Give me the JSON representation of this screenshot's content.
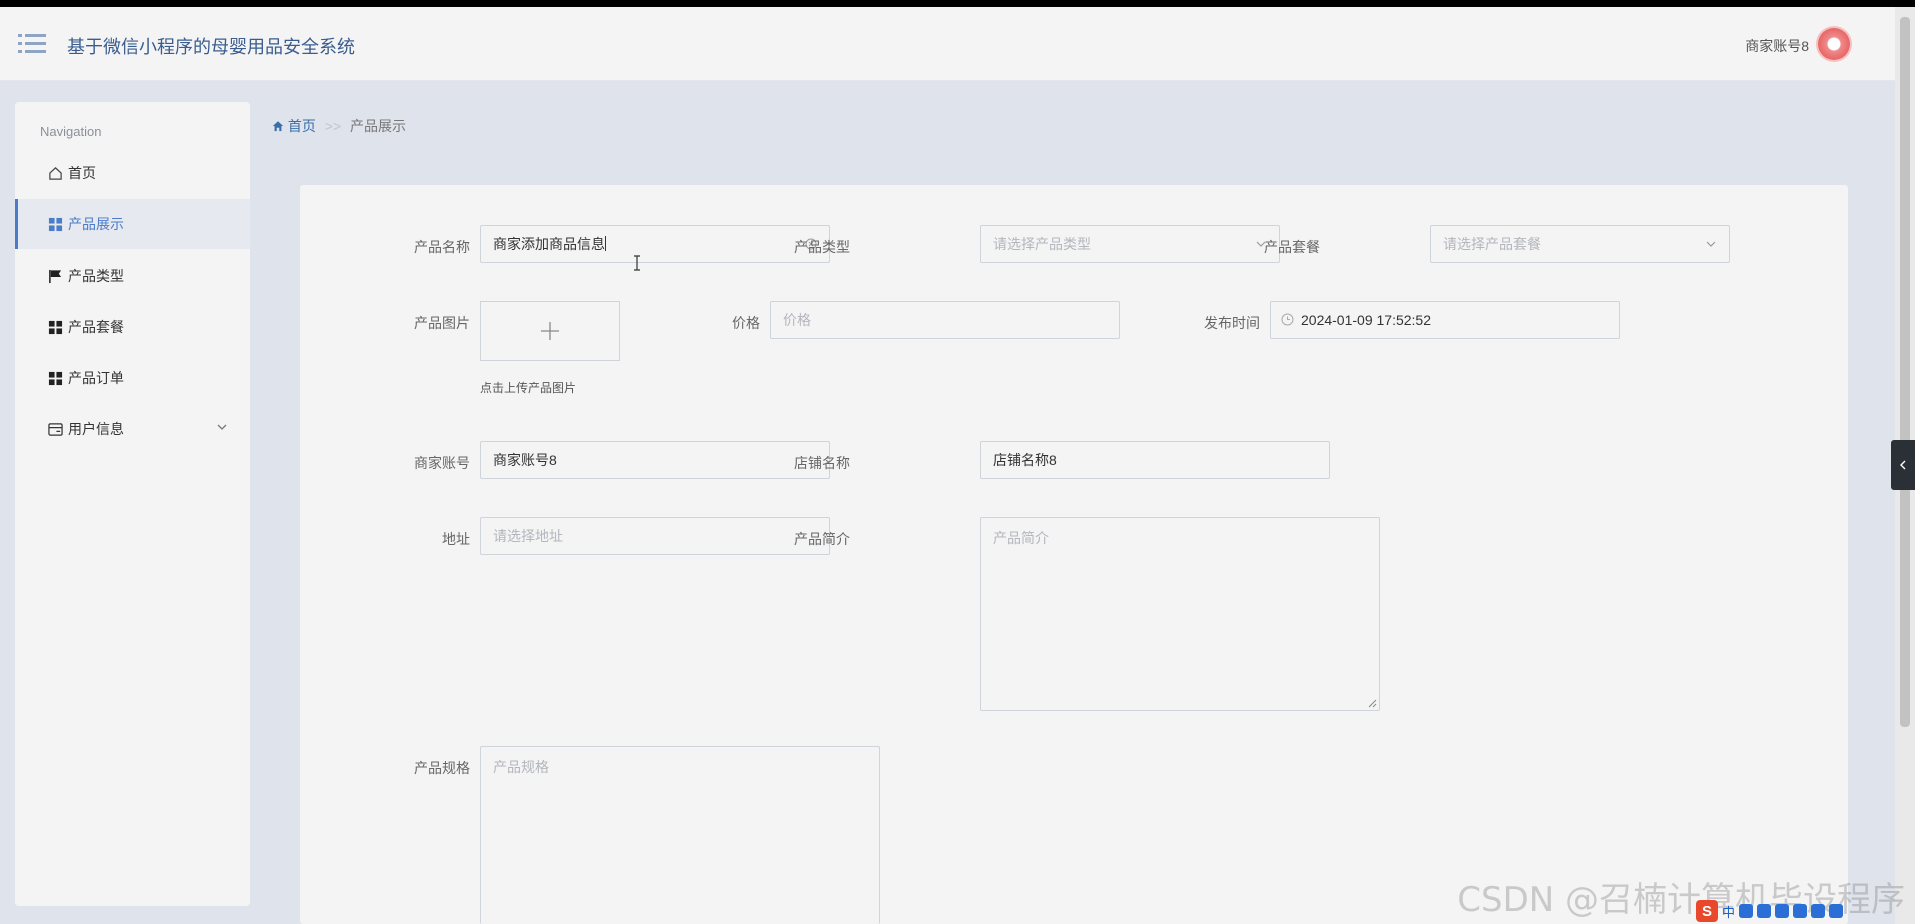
{
  "app": {
    "title": "基于微信小程序的母婴用品安全系统",
    "user_name": "商家账号8"
  },
  "sidebar": {
    "heading": "Navigation",
    "items": [
      {
        "label": "首页",
        "icon": "home-icon"
      },
      {
        "label": "产品展示",
        "icon": "grid-icon",
        "active": true
      },
      {
        "label": "产品类型",
        "icon": "flag-icon"
      },
      {
        "label": "产品套餐",
        "icon": "grid-icon"
      },
      {
        "label": "产品订单",
        "icon": "grid-icon"
      },
      {
        "label": "用户信息",
        "icon": "card-icon",
        "expandable": true
      }
    ]
  },
  "breadcrumb": {
    "home": "首页",
    "separator": ">>",
    "current": "产品展示"
  },
  "form": {
    "product_name": {
      "label": "产品名称",
      "value": "商家添加商品信息"
    },
    "product_type": {
      "label": "产品类型",
      "placeholder": "请选择产品类型"
    },
    "product_package": {
      "label": "产品套餐",
      "placeholder": "请选择产品套餐"
    },
    "product_image": {
      "label": "产品图片",
      "tip": "点击上传产品图片"
    },
    "price": {
      "label": "价格",
      "placeholder": "价格"
    },
    "publish_time": {
      "label": "发布时间",
      "value": "2024-01-09 17:52:52"
    },
    "merchant_account": {
      "label": "商家账号",
      "value": "商家账号8"
    },
    "shop_name": {
      "label": "店铺名称",
      "value": "店铺名称8"
    },
    "address": {
      "label": "地址",
      "placeholder": "请选择地址"
    },
    "product_intro": {
      "label": "产品简介",
      "placeholder": "产品简介"
    },
    "product_spec": {
      "label": "产品规格",
      "placeholder": "产品规格"
    }
  },
  "watermark": "CSDN @召楠计算机毕设程序",
  "ime": {
    "mode": "中"
  },
  "colors": {
    "accent": "#4a7cc9",
    "title": "#3a5d8f",
    "background": "#dfe3ec",
    "panel": "#f4f4f4"
  }
}
